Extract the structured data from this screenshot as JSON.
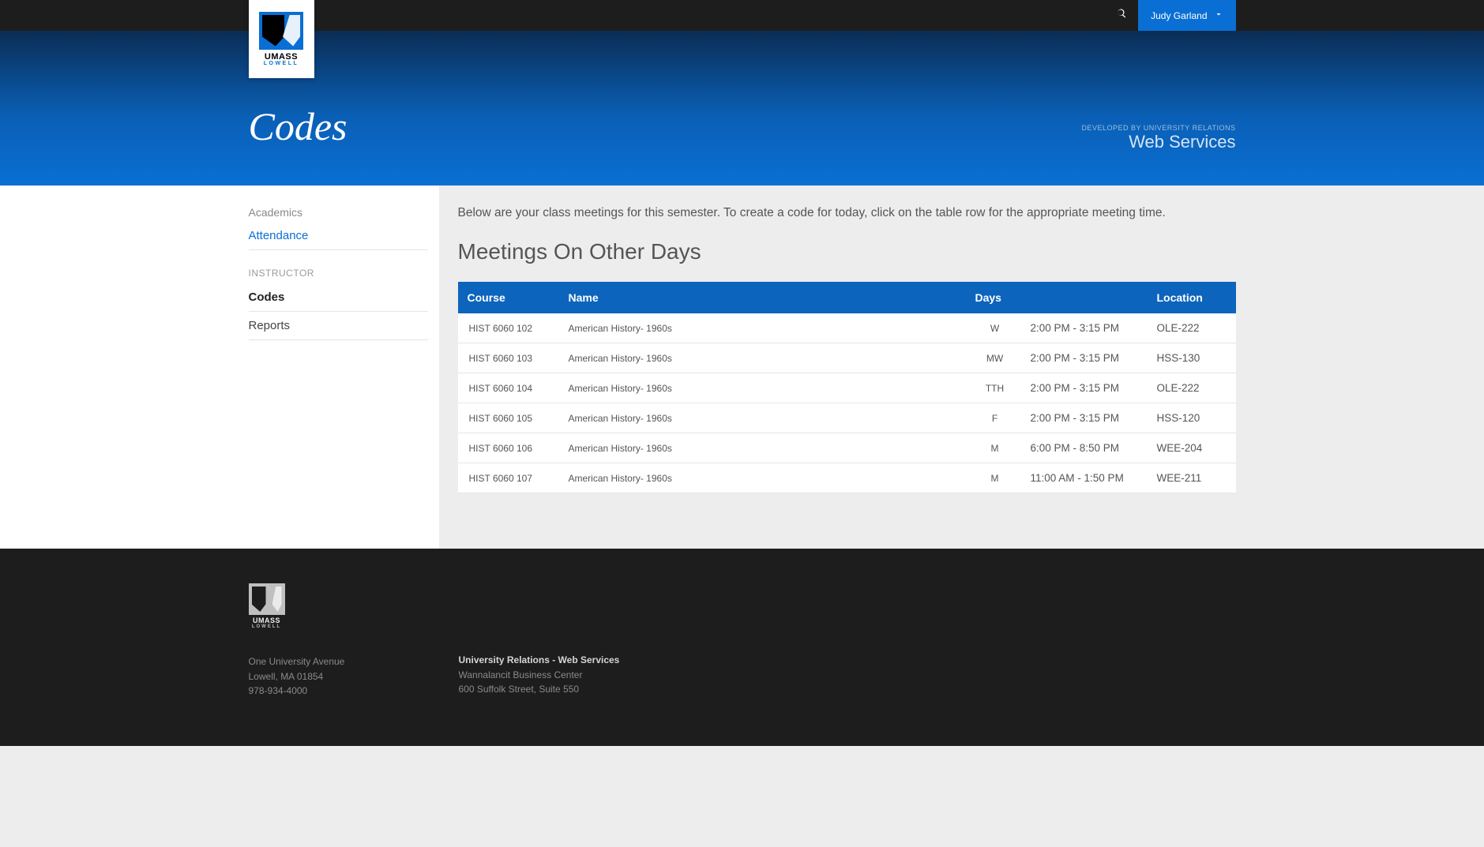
{
  "topbar": {
    "user_name": "Judy Garland"
  },
  "logo": {
    "line1": "UMASS",
    "line2": "LOWELL"
  },
  "hero": {
    "title": "Codes",
    "dev_line": "DEVELOPED BY UNIVERSITY RELATIONS",
    "web_services": "Web Services"
  },
  "sidebar": {
    "academics_label": "Academics",
    "attendance_label": "Attendance",
    "instructor_label": "INSTRUCTOR",
    "codes_label": "Codes",
    "reports_label": "Reports"
  },
  "main": {
    "intro": "Below are your class meetings for this semester. To create a code for today, click on the table row for the appropriate meeting time.",
    "section_heading": "Meetings On Other Days",
    "columns": {
      "course": "Course",
      "name": "Name",
      "days": "Days",
      "location": "Location"
    },
    "rows": [
      {
        "course": "HIST 6060 102",
        "name": "American History- 1960s",
        "days": "W",
        "time": "2:00 PM - 3:15 PM",
        "location": "OLE-222"
      },
      {
        "course": "HIST 6060 103",
        "name": "American History- 1960s",
        "days": "MW",
        "time": "2:00 PM - 3:15 PM",
        "location": "HSS-130"
      },
      {
        "course": "HIST 6060 104",
        "name": "American History- 1960s",
        "days": "TTH",
        "time": "2:00 PM - 3:15 PM",
        "location": "OLE-222"
      },
      {
        "course": "HIST 6060 105",
        "name": "American History- 1960s",
        "days": "F",
        "time": "2:00 PM - 3:15 PM",
        "location": "HSS-120"
      },
      {
        "course": "HIST 6060 106",
        "name": "American History- 1960s",
        "days": "M",
        "time": "6:00 PM - 8:50 PM",
        "location": "WEE-204"
      },
      {
        "course": "HIST 6060 107",
        "name": "American History- 1960s",
        "days": "M",
        "time": "11:00 AM - 1:50 PM",
        "location": "WEE-211"
      }
    ]
  },
  "footer": {
    "col1": {
      "line1": "One University Avenue",
      "line2": "Lowell, MA 01854",
      "line3": "978-934-4000"
    },
    "col2": {
      "title": "University Relations - Web Services",
      "line1": "Wannalancit Business Center",
      "line2": "600 Suffolk Street, Suite 550"
    }
  }
}
